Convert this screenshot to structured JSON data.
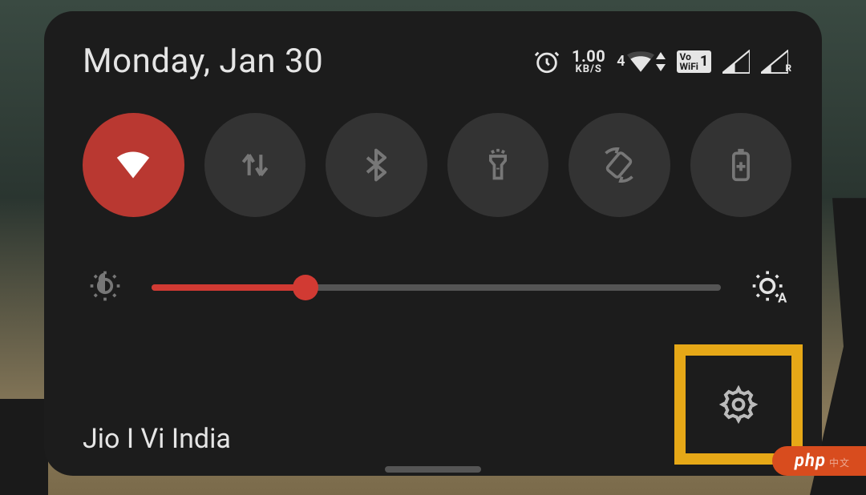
{
  "header": {
    "date": "Monday, Jan 30",
    "network_speed_value": "1.00",
    "network_speed_unit": "KB/S",
    "network_gen": "4",
    "vowifi_label_top": "Vo",
    "vowifi_label_bot": "WiFi",
    "vowifi_sim": "1",
    "signal2_letter": "R"
  },
  "tiles": [
    {
      "id": "wifi",
      "icon": "wifi-icon",
      "active": true,
      "label": "Wi-Fi"
    },
    {
      "id": "data",
      "icon": "mobile-data-icon",
      "active": false,
      "label": "Mobile data"
    },
    {
      "id": "bluetooth",
      "icon": "bluetooth-icon",
      "active": false,
      "label": "Bluetooth"
    },
    {
      "id": "flashlight",
      "icon": "flashlight-icon",
      "active": false,
      "label": "Flashlight"
    },
    {
      "id": "rotation",
      "icon": "auto-rotate-icon",
      "active": false,
      "label": "Auto-rotate"
    },
    {
      "id": "battery",
      "icon": "battery-saver-icon",
      "active": false,
      "label": "Battery saver"
    }
  ],
  "brightness": {
    "percent": 27,
    "auto": true
  },
  "footer": {
    "carrier": "Jio I Vi India"
  },
  "colors": {
    "panel_bg": "#1c1c1c",
    "tile_inactive": "#333333",
    "tile_active": "#b93831",
    "accent": "#d13a33",
    "highlight_box": "#e6a817",
    "text": "#e5e5e5"
  },
  "badge": {
    "text": "php"
  }
}
